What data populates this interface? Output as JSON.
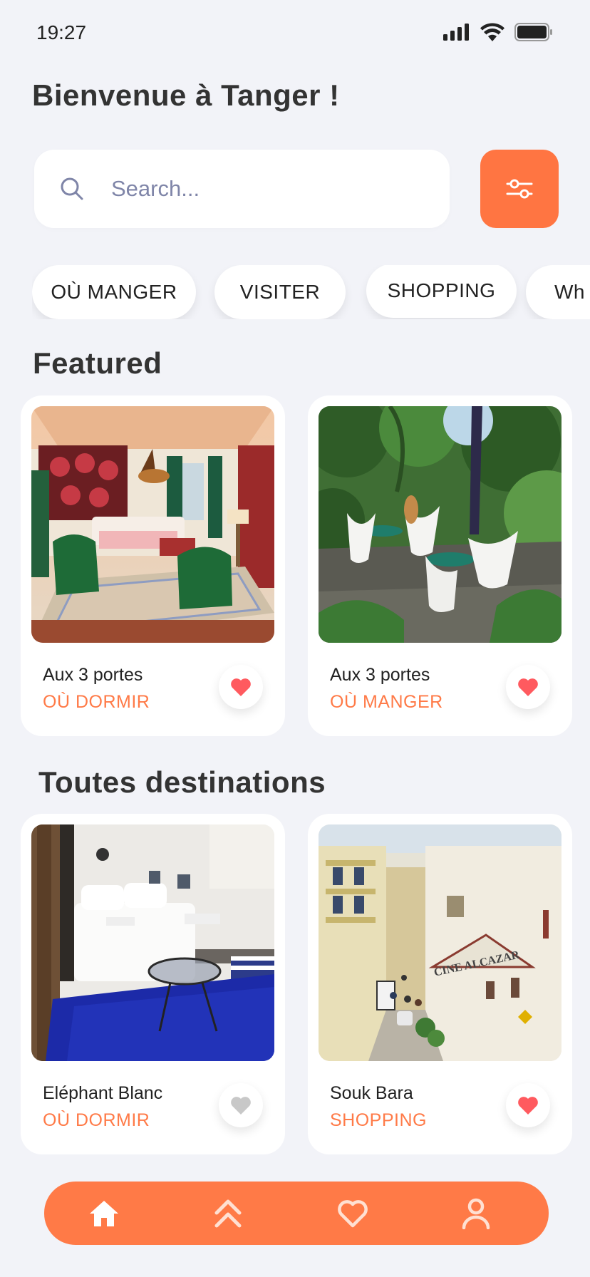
{
  "status_bar": {
    "time": "19:27",
    "icons": [
      "signal-icon",
      "wifi-icon",
      "battery-icon"
    ]
  },
  "header": {
    "title": "Bienvenue à Tanger !"
  },
  "search": {
    "placeholder": "Search...",
    "value": ""
  },
  "filter_button": {
    "icon": "sliders-icon",
    "color": "#ff7542"
  },
  "categories": [
    {
      "label": "OÙ MANGER"
    },
    {
      "label": "VISITER"
    },
    {
      "label": "SHOPPING"
    },
    {
      "label": "Wh"
    }
  ],
  "featured": {
    "title": "Featured",
    "cards": [
      {
        "name": "Aux 3 portes",
        "category": "OÙ DORMIR",
        "favorite": true,
        "photo": "riad-bedroom-photo"
      },
      {
        "name": "Aux 3 portes",
        "category": "OÙ MANGER",
        "favorite": true,
        "photo": "garden-terrace-photo"
      }
    ]
  },
  "all_destinations": {
    "title": "Toutes destinations",
    "cards": [
      {
        "name": "Eléphant Blanc",
        "category": "OÙ DORMIR",
        "favorite": false,
        "photo": "white-bedroom-photo"
      },
      {
        "name": "Souk Bara",
        "category": "SHOPPING",
        "favorite": true,
        "photo": "street-cine-alcazar-photo",
        "photo_sign": "CINE ALCAZAR"
      }
    ]
  },
  "bottom_nav": {
    "items": [
      {
        "icon": "home-icon",
        "active": true
      },
      {
        "icon": "double-chevron-up-icon",
        "active": false
      },
      {
        "icon": "heart-outline-icon",
        "active": false
      },
      {
        "icon": "user-icon",
        "active": false
      }
    ]
  },
  "colors": {
    "accent": "#ff7a47",
    "favorite_active": "#ff5a5f",
    "favorite_inactive": "#c8c8c8",
    "background": "#f2f3f8"
  }
}
